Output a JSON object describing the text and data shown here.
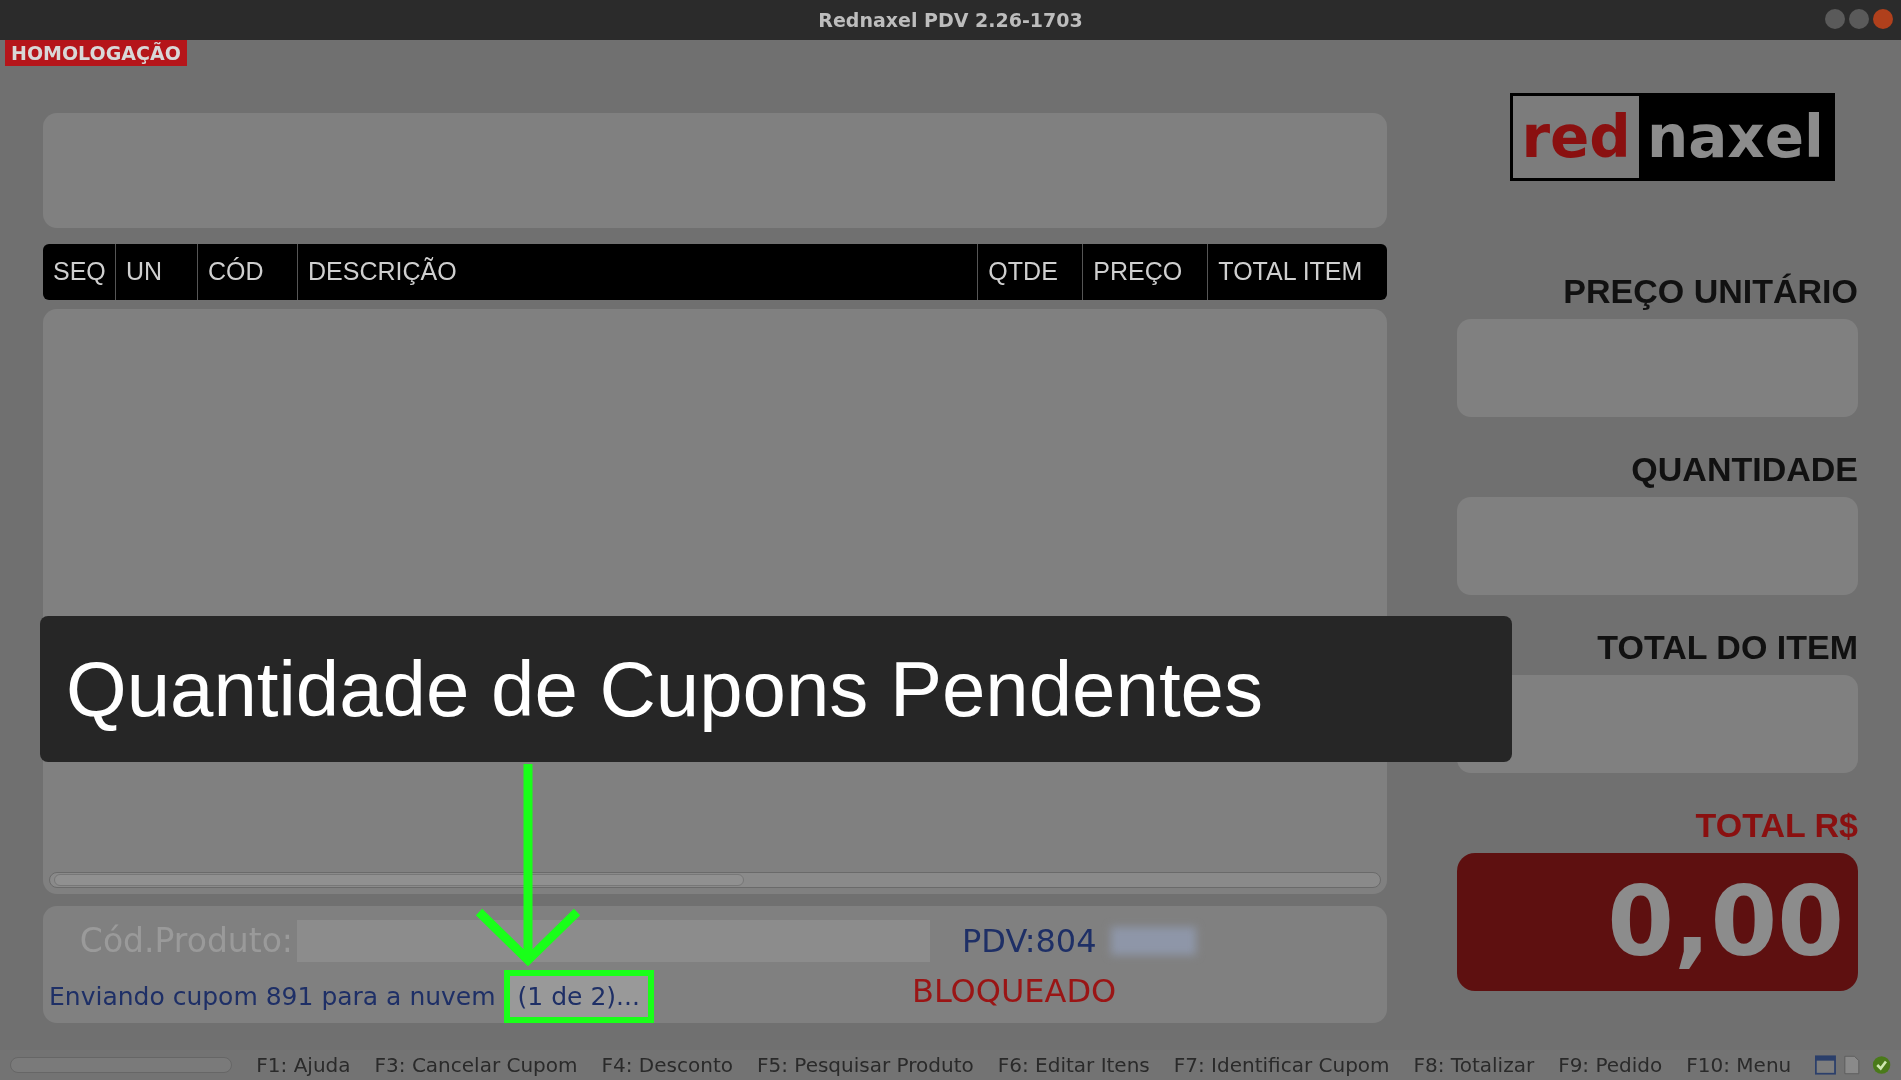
{
  "window": {
    "title": "Rednaxel PDV 2.26-1703"
  },
  "environment_badge": "HOMOLOGAÇÃO",
  "logo": {
    "part_1": "red",
    "part_2": "naxel"
  },
  "table": {
    "columns": [
      "SEQ",
      "UN",
      "CÓD",
      "DESCRIÇÃO",
      "QTDE",
      "PREÇO",
      "TOTAL ITEM"
    ]
  },
  "right_panel": {
    "fields": [
      {
        "label": "PREÇO UNITÁRIO"
      },
      {
        "label": "QUANTIDADE"
      },
      {
        "label": "TOTAL DO ITEM"
      }
    ],
    "total": {
      "label": "TOTAL R$",
      "value": "0,00"
    }
  },
  "product_entry": {
    "label": "Cód.Produto:"
  },
  "pdv": "PDV:804",
  "status": "BLOQUEADO",
  "sync_message": "Enviando cupom 891 para a nuvem",
  "pending_count": "(1 de 2)...",
  "progress": {
    "level": 0
  },
  "shortcuts": [
    "F1: Ajuda",
    "F3: Cancelar Cupom",
    "F4: Desconto",
    "F5: Pesquisar Produto",
    "F6: Editar Itens",
    "F7: Identificar Cupom",
    "F8: Totalizar",
    "F9: Pedido",
    "F10: Menu"
  ],
  "caption": "Quantidade de Cupons Pendentes"
}
